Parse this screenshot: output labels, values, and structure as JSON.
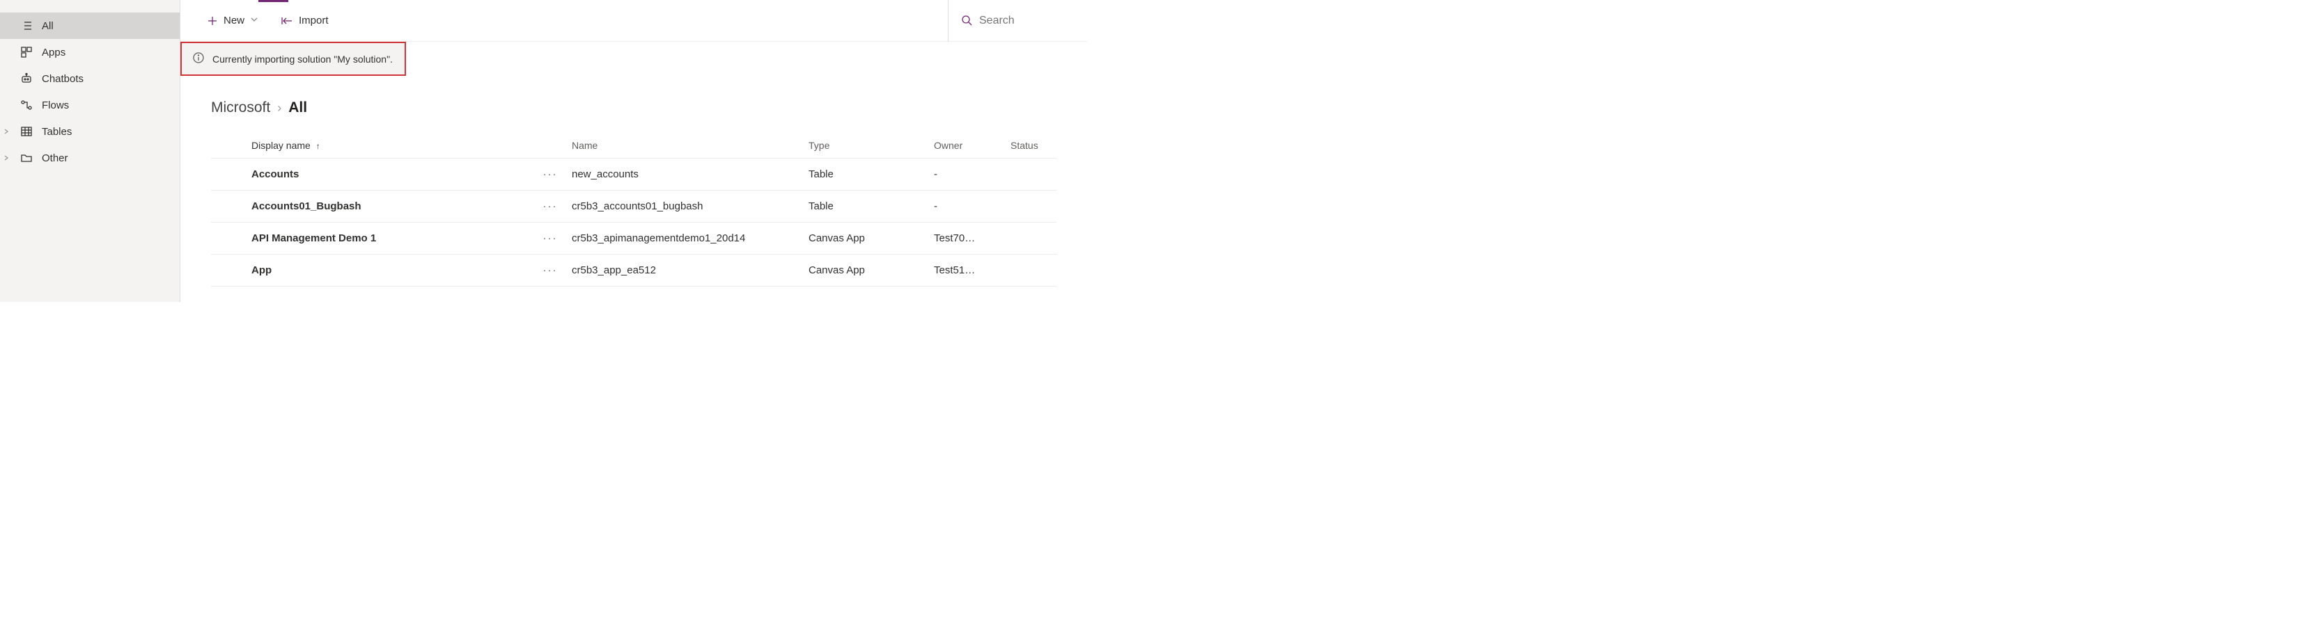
{
  "sidebar": {
    "items": [
      {
        "label": "All",
        "icon": "list-icon",
        "selected": true,
        "caret": false
      },
      {
        "label": "Apps",
        "icon": "apps-icon",
        "selected": false,
        "caret": false
      },
      {
        "label": "Chatbots",
        "icon": "bot-icon",
        "selected": false,
        "caret": false
      },
      {
        "label": "Flows",
        "icon": "flow-icon",
        "selected": false,
        "caret": false
      },
      {
        "label": "Tables",
        "icon": "table-icon",
        "selected": false,
        "caret": true
      },
      {
        "label": "Other",
        "icon": "folder-icon",
        "selected": false,
        "caret": true
      }
    ]
  },
  "commandBar": {
    "new_label": "New",
    "import_label": "Import"
  },
  "search": {
    "placeholder": "Search"
  },
  "banner": {
    "message": "Currently importing solution \"My solution\"."
  },
  "breadcrumb": {
    "parent": "Microsoft",
    "current": "All"
  },
  "table": {
    "columns": {
      "display_name": "Display name",
      "name": "Name",
      "type": "Type",
      "owner": "Owner",
      "status": "Status"
    },
    "rows": [
      {
        "display_name": "Accounts",
        "name": "new_accounts",
        "type": "Table",
        "owner": "-",
        "status": ""
      },
      {
        "display_name": "Accounts01_Bugbash",
        "name": "cr5b3_accounts01_bugbash",
        "type": "Table",
        "owner": "-",
        "status": ""
      },
      {
        "display_name": "API Management Demo 1",
        "name": "cr5b3_apimanagementdemo1_20d14",
        "type": "Canvas App",
        "owner": "Test70…",
        "status": ""
      },
      {
        "display_name": "App",
        "name": "cr5b3_app_ea512",
        "type": "Canvas App",
        "owner": "Test51…",
        "status": ""
      }
    ]
  }
}
